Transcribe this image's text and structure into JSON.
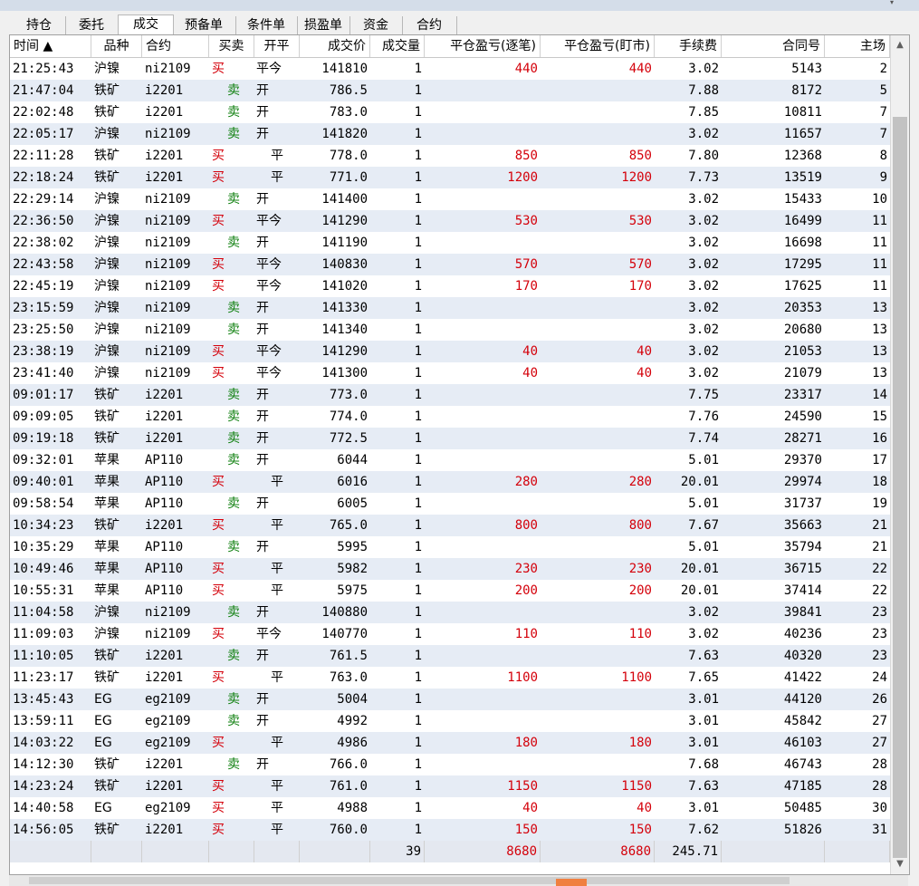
{
  "tabs": [
    {
      "label": "持仓",
      "active": false
    },
    {
      "label": "委托",
      "active": false
    },
    {
      "label": "成交",
      "active": true
    },
    {
      "label": "预备单",
      "active": false
    },
    {
      "label": "条件单",
      "active": false
    },
    {
      "label": "损盈单",
      "active": false
    },
    {
      "label": "资金",
      "active": false
    },
    {
      "label": "合约",
      "active": false
    }
  ],
  "columns": [
    "时间 ▲",
    "品种",
    "合约",
    "买卖",
    "开平",
    "成交价",
    "成交量",
    "平仓盈亏(逐笔)",
    "平仓盈亏(盯市)",
    "手续费",
    "合同号",
    "主场"
  ],
  "rows": [
    [
      "21:25:43",
      "沪镍",
      "ni2109",
      "买",
      "平今",
      "141810",
      "1",
      "440",
      "440",
      "3.02",
      "5143",
      "2"
    ],
    [
      "21:47:04",
      "铁矿",
      "i2201",
      "卖",
      "开",
      "786.5",
      "1",
      "",
      "",
      "7.88",
      "8172",
      "5"
    ],
    [
      "22:02:48",
      "铁矿",
      "i2201",
      "卖",
      "开",
      "783.0",
      "1",
      "",
      "",
      "7.85",
      "10811",
      "7"
    ],
    [
      "22:05:17",
      "沪镍",
      "ni2109",
      "卖",
      "开",
      "141820",
      "1",
      "",
      "",
      "3.02",
      "11657",
      "7"
    ],
    [
      "22:11:28",
      "铁矿",
      "i2201",
      "买",
      "平",
      "778.0",
      "1",
      "850",
      "850",
      "7.80",
      "12368",
      "8"
    ],
    [
      "22:18:24",
      "铁矿",
      "i2201",
      "买",
      "平",
      "771.0",
      "1",
      "1200",
      "1200",
      "7.73",
      "13519",
      "9"
    ],
    [
      "22:29:14",
      "沪镍",
      "ni2109",
      "卖",
      "开",
      "141400",
      "1",
      "",
      "",
      "3.02",
      "15433",
      "10"
    ],
    [
      "22:36:50",
      "沪镍",
      "ni2109",
      "买",
      "平今",
      "141290",
      "1",
      "530",
      "530",
      "3.02",
      "16499",
      "11"
    ],
    [
      "22:38:02",
      "沪镍",
      "ni2109",
      "卖",
      "开",
      "141190",
      "1",
      "",
      "",
      "3.02",
      "16698",
      "11"
    ],
    [
      "22:43:58",
      "沪镍",
      "ni2109",
      "买",
      "平今",
      "140830",
      "1",
      "570",
      "570",
      "3.02",
      "17295",
      "11"
    ],
    [
      "22:45:19",
      "沪镍",
      "ni2109",
      "买",
      "平今",
      "141020",
      "1",
      "170",
      "170",
      "3.02",
      "17625",
      "11"
    ],
    [
      "23:15:59",
      "沪镍",
      "ni2109",
      "卖",
      "开",
      "141330",
      "1",
      "",
      "",
      "3.02",
      "20353",
      "13"
    ],
    [
      "23:25:50",
      "沪镍",
      "ni2109",
      "卖",
      "开",
      "141340",
      "1",
      "",
      "",
      "3.02",
      "20680",
      "13"
    ],
    [
      "23:38:19",
      "沪镍",
      "ni2109",
      "买",
      "平今",
      "141290",
      "1",
      "40",
      "40",
      "3.02",
      "21053",
      "13"
    ],
    [
      "23:41:40",
      "沪镍",
      "ni2109",
      "买",
      "平今",
      "141300",
      "1",
      "40",
      "40",
      "3.02",
      "21079",
      "13"
    ],
    [
      "09:01:17",
      "铁矿",
      "i2201",
      "卖",
      "开",
      "773.0",
      "1",
      "",
      "",
      "7.75",
      "23317",
      "14"
    ],
    [
      "09:09:05",
      "铁矿",
      "i2201",
      "卖",
      "开",
      "774.0",
      "1",
      "",
      "",
      "7.76",
      "24590",
      "15"
    ],
    [
      "09:19:18",
      "铁矿",
      "i2201",
      "卖",
      "开",
      "772.5",
      "1",
      "",
      "",
      "7.74",
      "28271",
      "16"
    ],
    [
      "09:32:01",
      "苹果",
      "AP110",
      "卖",
      "开",
      "6044",
      "1",
      "",
      "",
      "5.01",
      "29370",
      "17"
    ],
    [
      "09:40:01",
      "苹果",
      "AP110",
      "买",
      "平",
      "6016",
      "1",
      "280",
      "280",
      "20.01",
      "29974",
      "18"
    ],
    [
      "09:58:54",
      "苹果",
      "AP110",
      "卖",
      "开",
      "6005",
      "1",
      "",
      "",
      "5.01",
      "31737",
      "19"
    ],
    [
      "10:34:23",
      "铁矿",
      "i2201",
      "买",
      "平",
      "765.0",
      "1",
      "800",
      "800",
      "7.67",
      "35663",
      "21"
    ],
    [
      "10:35:29",
      "苹果",
      "AP110",
      "卖",
      "开",
      "5995",
      "1",
      "",
      "",
      "5.01",
      "35794",
      "21"
    ],
    [
      "10:49:46",
      "苹果",
      "AP110",
      "买",
      "平",
      "5982",
      "1",
      "230",
      "230",
      "20.01",
      "36715",
      "22"
    ],
    [
      "10:55:31",
      "苹果",
      "AP110",
      "买",
      "平",
      "5975",
      "1",
      "200",
      "200",
      "20.01",
      "37414",
      "22"
    ],
    [
      "11:04:58",
      "沪镍",
      "ni2109",
      "卖",
      "开",
      "140880",
      "1",
      "",
      "",
      "3.02",
      "39841",
      "23"
    ],
    [
      "11:09:03",
      "沪镍",
      "ni2109",
      "买",
      "平今",
      "140770",
      "1",
      "110",
      "110",
      "3.02",
      "40236",
      "23"
    ],
    [
      "11:10:05",
      "铁矿",
      "i2201",
      "卖",
      "开",
      "761.5",
      "1",
      "",
      "",
      "7.63",
      "40320",
      "23"
    ],
    [
      "11:23:17",
      "铁矿",
      "i2201",
      "买",
      "平",
      "763.0",
      "1",
      "1100",
      "1100",
      "7.65",
      "41422",
      "24"
    ],
    [
      "13:45:43",
      "EG",
      "eg2109",
      "卖",
      "开",
      "5004",
      "1",
      "",
      "",
      "3.01",
      "44120",
      "26"
    ],
    [
      "13:59:11",
      "EG",
      "eg2109",
      "卖",
      "开",
      "4992",
      "1",
      "",
      "",
      "3.01",
      "45842",
      "27"
    ],
    [
      "14:03:22",
      "EG",
      "eg2109",
      "买",
      "平",
      "4986",
      "1",
      "180",
      "180",
      "3.01",
      "46103",
      "27"
    ],
    [
      "14:12:30",
      "铁矿",
      "i2201",
      "卖",
      "开",
      "766.0",
      "1",
      "",
      "",
      "7.68",
      "46743",
      "28"
    ],
    [
      "14:23:24",
      "铁矿",
      "i2201",
      "买",
      "平",
      "761.0",
      "1",
      "1150",
      "1150",
      "7.63",
      "47185",
      "28"
    ],
    [
      "14:40:58",
      "EG",
      "eg2109",
      "买",
      "平",
      "4988",
      "1",
      "40",
      "40",
      "3.01",
      "50485",
      "30"
    ],
    [
      "14:56:05",
      "铁矿",
      "i2201",
      "买",
      "平",
      "760.0",
      "1",
      "150",
      "150",
      "7.62",
      "51826",
      "31"
    ]
  ],
  "summary": {
    "volume": "39",
    "pnl_trade": "8680",
    "pnl_mtm": "8680",
    "fee": "245.71"
  },
  "colors": {
    "buy": "#d4000a",
    "sell": "#108010",
    "alt_row": "#e6ecf5"
  }
}
